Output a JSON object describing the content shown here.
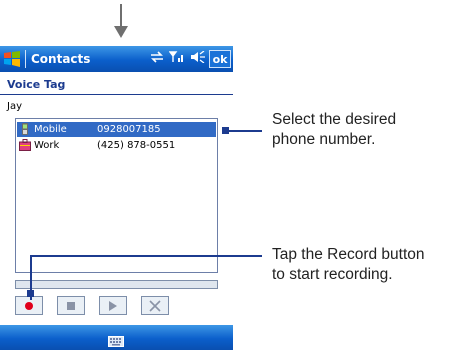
{
  "titlebar": {
    "title": "Contacts",
    "ok_label": "ok"
  },
  "header": {
    "title": "Voice Tag"
  },
  "contact": {
    "name": "Jay"
  },
  "numbers": [
    {
      "type": "Mobile",
      "number": "0928007185",
      "selected": true,
      "icon": "mobile-phone-icon"
    },
    {
      "type": "Work",
      "number": "(425) 878-0551",
      "selected": false,
      "icon": "work-briefcase-icon"
    }
  ],
  "controls": {
    "record": "record-icon",
    "stop": "stop-icon",
    "play": "play-icon",
    "delete": "delete-icon"
  },
  "callouts": {
    "select_line1": "Select the desired",
    "select_line2": "phone number.",
    "record_line1": "Tap the Record button",
    "record_line2": "to start recording."
  },
  "colors": {
    "titlebar": "#0b5fcb",
    "selection": "#316ac5",
    "callout": "#1c3b8f",
    "record": "#e0001b"
  }
}
